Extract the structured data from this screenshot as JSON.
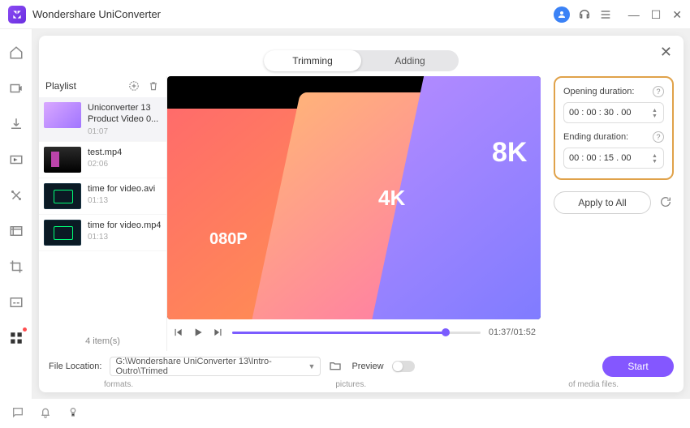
{
  "titlebar": {
    "title": "Wondershare UniConverter"
  },
  "tabs": {
    "trimming": "Trimming",
    "adding": "Adding"
  },
  "playlist": {
    "title": "Playlist",
    "items": [
      {
        "name": "Uniconverter 13 Product Video 0...",
        "duration": "01:07"
      },
      {
        "name": "test.mp4",
        "duration": "02:06"
      },
      {
        "name": "time for video.avi",
        "duration": "01:13"
      },
      {
        "name": "time for video.mp4",
        "duration": "01:13"
      }
    ],
    "footer": "4 item(s)"
  },
  "preview": {
    "labels": {
      "a": "080P",
      "b": "4K",
      "c": "8K"
    },
    "timecode": "01:37/01:52",
    "progress_pct": 86
  },
  "durations": {
    "opening_label": "Opening duration:",
    "ending_label": "Ending duration:",
    "opening_value": "00 : 00 : 30 . 00",
    "ending_value": "00 : 00 : 15 . 00"
  },
  "buttons": {
    "apply_all": "Apply to All",
    "start": "Start"
  },
  "bottom": {
    "file_location_label": "File Location:",
    "path": "G:\\Wondershare UniConverter 13\\Intro-Outro\\Trimed",
    "preview_label": "Preview"
  },
  "hints": {
    "a": "formats.",
    "b": "pictures.",
    "c": "of media files."
  }
}
